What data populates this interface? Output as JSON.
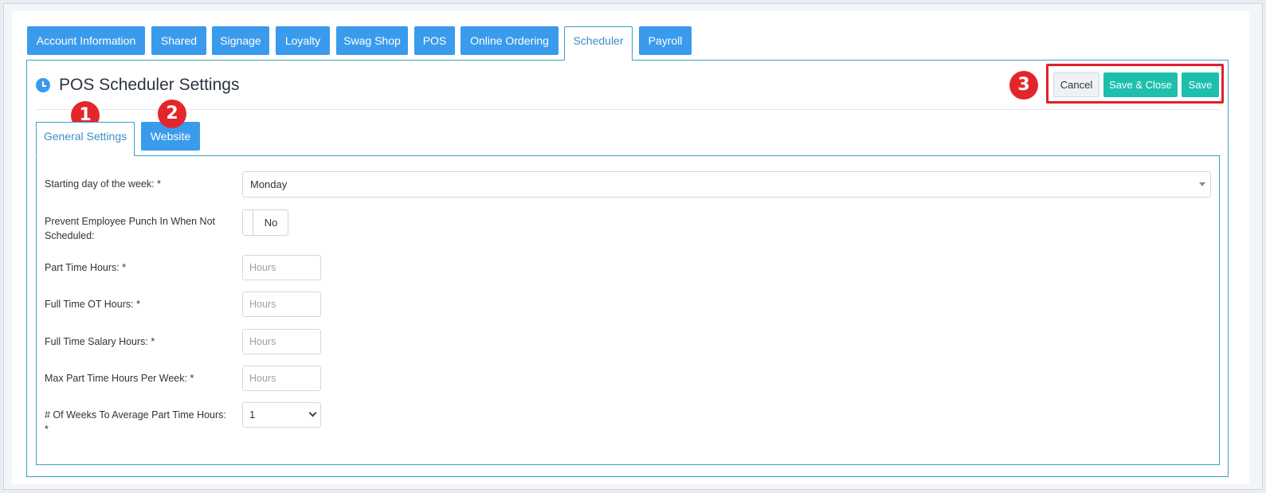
{
  "top_tabs": [
    {
      "label": "Account Information"
    },
    {
      "label": "Shared"
    },
    {
      "label": "Signage"
    },
    {
      "label": "Loyalty"
    },
    {
      "label": "Swag Shop"
    },
    {
      "label": "POS"
    },
    {
      "label": "Online Ordering"
    },
    {
      "label": "Scheduler",
      "active": true
    },
    {
      "label": "Payroll"
    }
  ],
  "header": {
    "icon": "clock-icon",
    "title": "POS Scheduler Settings"
  },
  "actions": {
    "cancel_label": "Cancel",
    "save_close_label": "Save & Close",
    "save_label": "Save"
  },
  "sub_tabs": [
    {
      "label": "General Settings",
      "active": true
    },
    {
      "label": "Website"
    }
  ],
  "callouts": [
    "1",
    "2",
    "3"
  ],
  "form": {
    "starting_day": {
      "label": "Starting day of the week: *",
      "value": "Monday"
    },
    "prevent_punch": {
      "label": "Prevent Employee Punch In When Not Scheduled:",
      "value": "No"
    },
    "part_time_hours": {
      "label": "Part Time Hours: *",
      "placeholder": "Hours"
    },
    "full_time_ot_hours": {
      "label": "Full Time OT Hours: *",
      "placeholder": "Hours"
    },
    "full_time_salary_hours": {
      "label": "Full Time Salary Hours: *",
      "placeholder": "Hours"
    },
    "max_part_time_hours": {
      "label": "Max Part Time Hours Per Week: *",
      "placeholder": "Hours"
    },
    "weeks_to_average": {
      "label": "# Of Weeks To Average Part Time Hours: *",
      "value": "1"
    }
  },
  "colors": {
    "tab_blue": "#3a9bec",
    "teal": "#1ebfad",
    "callout_red": "#e3262b",
    "border_blue": "#3aa0c6"
  }
}
